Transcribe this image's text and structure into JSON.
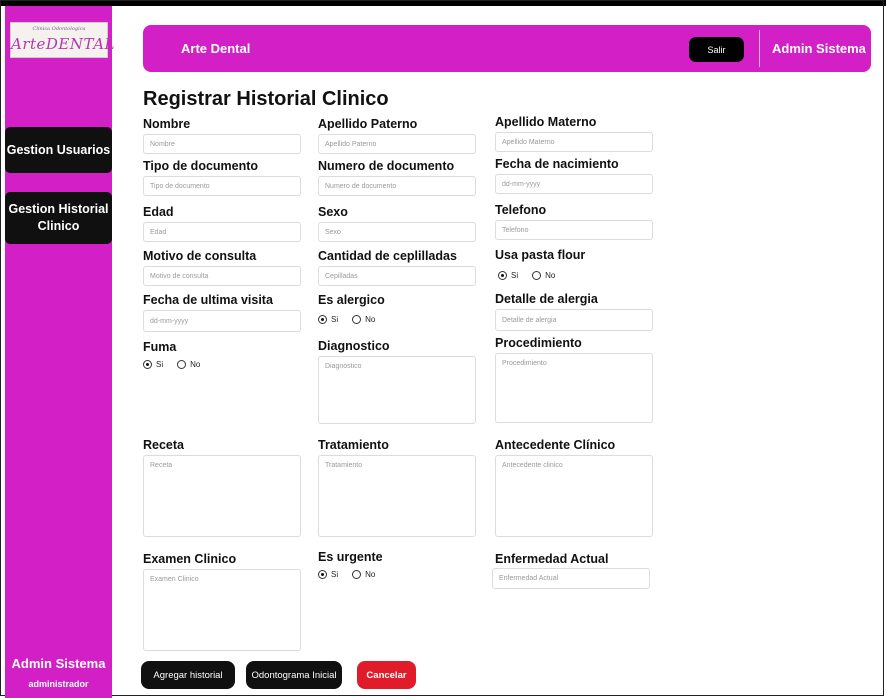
{
  "logo": {
    "tagline": "Clinica Odontologica",
    "wordmark": "ArteDENTAL"
  },
  "sidebar": {
    "items": [
      {
        "label": "Gestion Usuarios"
      },
      {
        "label_line1": "Gestion Historial",
        "label_line2": "Clinico"
      }
    ],
    "user_name": "Admin Sistema",
    "user_role": "administrador"
  },
  "header": {
    "brand": "Arte Dental",
    "logout_label": "Salir",
    "user_name": "Admin Sistema"
  },
  "form": {
    "title": "Registrar Historial Clinico",
    "nombre": {
      "label": "Nombre",
      "placeholder": "Nombre"
    },
    "apellido_paterno": {
      "label": "Apellido Paterno",
      "placeholder": "Apellido Paterno"
    },
    "apellido_materno": {
      "label": "Apellido Materno",
      "placeholder": "Apellido Materno"
    },
    "tipo_documento": {
      "label": "Tipo de documento",
      "placeholder": "Tipo de documento"
    },
    "numero_documento": {
      "label": "Numero de documento",
      "placeholder": "Numero de documento"
    },
    "fecha_nacimiento": {
      "label": "Fecha de nacimiento",
      "placeholder": "dd-mm-yyyy"
    },
    "edad": {
      "label": "Edad",
      "placeholder": "Edad"
    },
    "sexo": {
      "label": "Sexo",
      "placeholder": "Sexo"
    },
    "telefono": {
      "label": "Telefono",
      "placeholder": "Telefono"
    },
    "motivo_consulta": {
      "label": "Motivo de consulta",
      "placeholder": "Motivo de consulta"
    },
    "cantidad_cepilladas": {
      "label": "Cantidad de ceplilladas",
      "placeholder": "Cepilladas"
    },
    "usa_pasta_flour": {
      "label": "Usa pasta flour",
      "opt_yes": "Si",
      "opt_no": "No",
      "selected": "Si"
    },
    "fecha_ultima_visita": {
      "label": "Fecha de ultima visita",
      "placeholder": "dd-mm-yyyy"
    },
    "es_alergico": {
      "label": "Es alergico",
      "opt_yes": "Si",
      "opt_no": "No",
      "selected": "Si"
    },
    "detalle_alergia": {
      "label": "Detalle de alergia",
      "placeholder": "Detalle de alergia"
    },
    "fuma": {
      "label": "Fuma",
      "opt_yes": "Si",
      "opt_no": "No",
      "selected": "Si"
    },
    "diagnostico": {
      "label": "Diagnostico",
      "placeholder": "Diagnostico"
    },
    "procedimiento": {
      "label": "Procedimiento",
      "placeholder": "Procedimiento"
    },
    "receta": {
      "label": "Receta",
      "placeholder": "Receta"
    },
    "tratamiento": {
      "label": "Tratamiento",
      "placeholder": "Tratamiento"
    },
    "antecedente_clinico": {
      "label": "Antecedente Clínico",
      "placeholder": "Antecedente clinico"
    },
    "examen_clinico": {
      "label": "Examen Clinico",
      "placeholder": "Examen Clinico"
    },
    "es_urgente": {
      "label": "Es urgente",
      "opt_yes": "Si",
      "opt_no": "No",
      "selected": "Si"
    },
    "enfermedad_actual": {
      "label": "Enfermedad Actual",
      "placeholder": "Enfermedad Actual"
    }
  },
  "buttons": {
    "agregar": "Agregar historial",
    "odontograma": "Odontograma Inicial",
    "cancelar": "Cancelar"
  },
  "colors": {
    "brand_magenta": "#d21fc6",
    "cancel_red": "#e01b2a",
    "dark": "#101010"
  }
}
